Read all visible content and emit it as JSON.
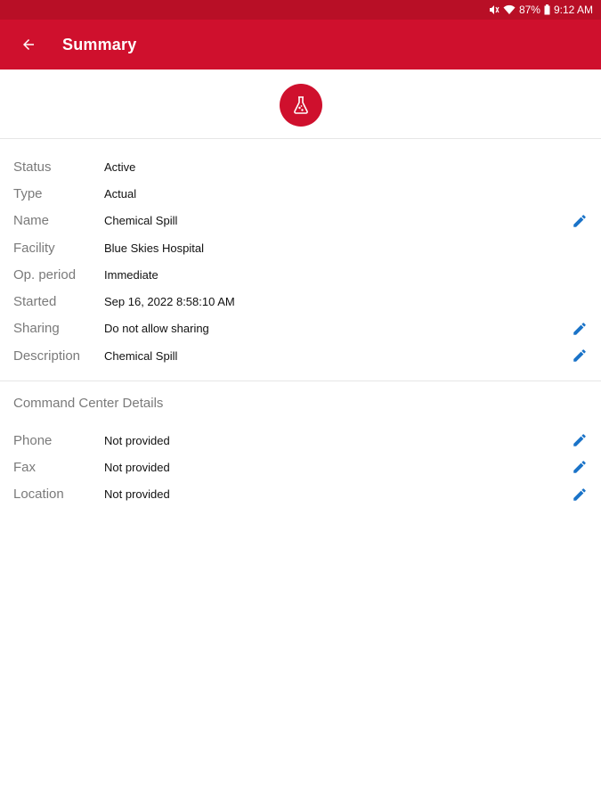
{
  "status_bar": {
    "icons": [
      "mute-icon",
      "wifi-icon",
      "battery-icon"
    ],
    "battery": "87%",
    "time": "9:12 AM"
  },
  "app_bar": {
    "title": "Summary",
    "back_icon": "arrow-back-icon",
    "color": "#cf102d"
  },
  "header": {
    "icon": "flask-icon"
  },
  "summary_rows": [
    {
      "label": "Status",
      "value": "Active",
      "editable": false
    },
    {
      "label": "Type",
      "value": "Actual",
      "editable": false
    },
    {
      "label": "Name",
      "value": "Chemical Spill",
      "editable": true
    },
    {
      "label": "Facility",
      "value": "Blue Skies Hospital",
      "editable": false
    },
    {
      "label": "Op. period",
      "value": "Immediate",
      "editable": false
    },
    {
      "label": "Started",
      "value": "Sep 16, 2022 8:58:10 AM",
      "editable": false
    },
    {
      "label": "Sharing",
      "value": "Do not allow sharing",
      "editable": true
    },
    {
      "label": "Description",
      "value": "Chemical Spill",
      "editable": true
    }
  ],
  "command_center": {
    "title": "Command Center Details",
    "rows": [
      {
        "label": "Phone",
        "value": "Not provided",
        "editable": true
      },
      {
        "label": "Fax",
        "value": "Not provided",
        "editable": true
      },
      {
        "label": "Location",
        "value": "Not provided",
        "editable": true
      }
    ]
  },
  "colors": {
    "accent": "#cf102d",
    "edit_icon": "#1a73c8",
    "label": "#7a7a7a"
  }
}
